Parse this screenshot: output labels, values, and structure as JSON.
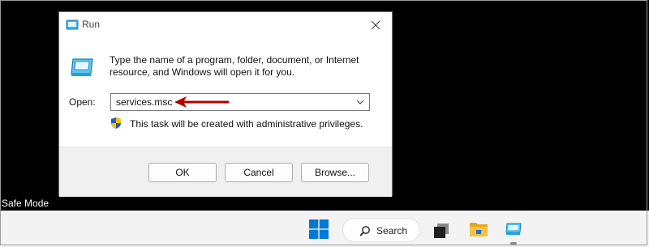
{
  "dialog": {
    "title": "Run",
    "description": "Type the name of a program, folder, document, or Internet resource, and Windows will open it for you.",
    "open_label": "Open:",
    "open_value": "services.msc",
    "admin_note": "This task will be created with administrative privileges.",
    "buttons": {
      "ok": "OK",
      "cancel": "Cancel",
      "browse": "Browse..."
    }
  },
  "desktop": {
    "safe_mode_label": "Safe Mode"
  },
  "taskbar": {
    "search_label": "Search",
    "icons": [
      "windows-start-icon",
      "search-icon",
      "task-view-icon",
      "file-explorer-icon",
      "run-app-icon"
    ]
  },
  "colors": {
    "annotation_arrow": "#b00000",
    "start_blue": "#0078d4",
    "folder_yellow": "#f5c242"
  }
}
